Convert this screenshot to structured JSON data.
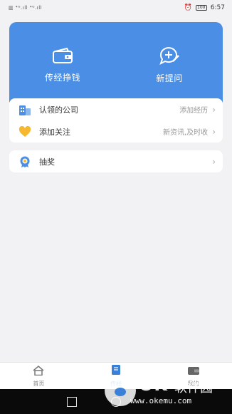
{
  "status_bar": {
    "left": "▥ ⁴ᴳ.ıll ⁴ᴳ.ıll",
    "battery": "100",
    "time": "6:57"
  },
  "hero": {
    "left_label": "传经挣钱",
    "right_label": "新提问"
  },
  "group1": {
    "rows": [
      {
        "label": "认领的公司",
        "value": "添加经历",
        "icon": "building-icon"
      },
      {
        "label": "添加关注",
        "value": "新资讯,及时收",
        "icon": "heart-icon"
      }
    ]
  },
  "group2": {
    "rows": [
      {
        "label": "抽奖",
        "value": "",
        "icon": "award-icon"
      }
    ]
  },
  "tabs": [
    {
      "label": "首页",
      "icon": "home-icon"
    },
    {
      "label": "传经",
      "icon": "book-icon"
    },
    {
      "label": "我的",
      "icon": "wallet-icon"
    }
  ],
  "watermark": {
    "brand": "OK",
    "cn": "软件园",
    "url": "www.okemu.com"
  },
  "colors": {
    "accent": "#4a8ee6",
    "tab_active": "#3a7fd8"
  }
}
